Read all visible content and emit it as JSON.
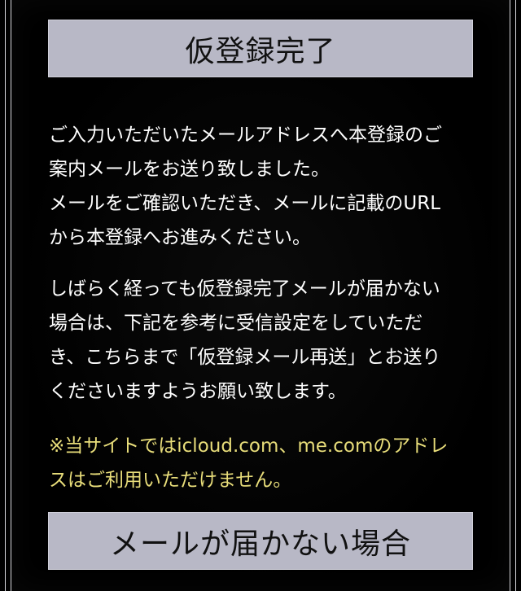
{
  "section_title": "仮登録完了",
  "paragraph_1": "ご入力いただいたメールアドレスへ本登録のご\n案内メールをお送り致しました。\nメールをご確認いただき、メールに記載のURL\nから本登録へお進みください。",
  "paragraph_2": "しばらく経っても仮登録完了メールが届かない\n場合は、下記を参考に受信設定をしていただ\nき、こちらまで「仮登録メール再送」とお送り\nくださいますようお願い致します。",
  "notice": "※当サイトではicloud.com、me.comのアドレ\nスはご利用いただけません。",
  "next_section_title": "メールが届かない場合",
  "colors": {
    "background": "#000000",
    "heading_bg": "#b8b8c6",
    "notice_text": "#e8dd7a",
    "body_text": "#ffffff"
  }
}
